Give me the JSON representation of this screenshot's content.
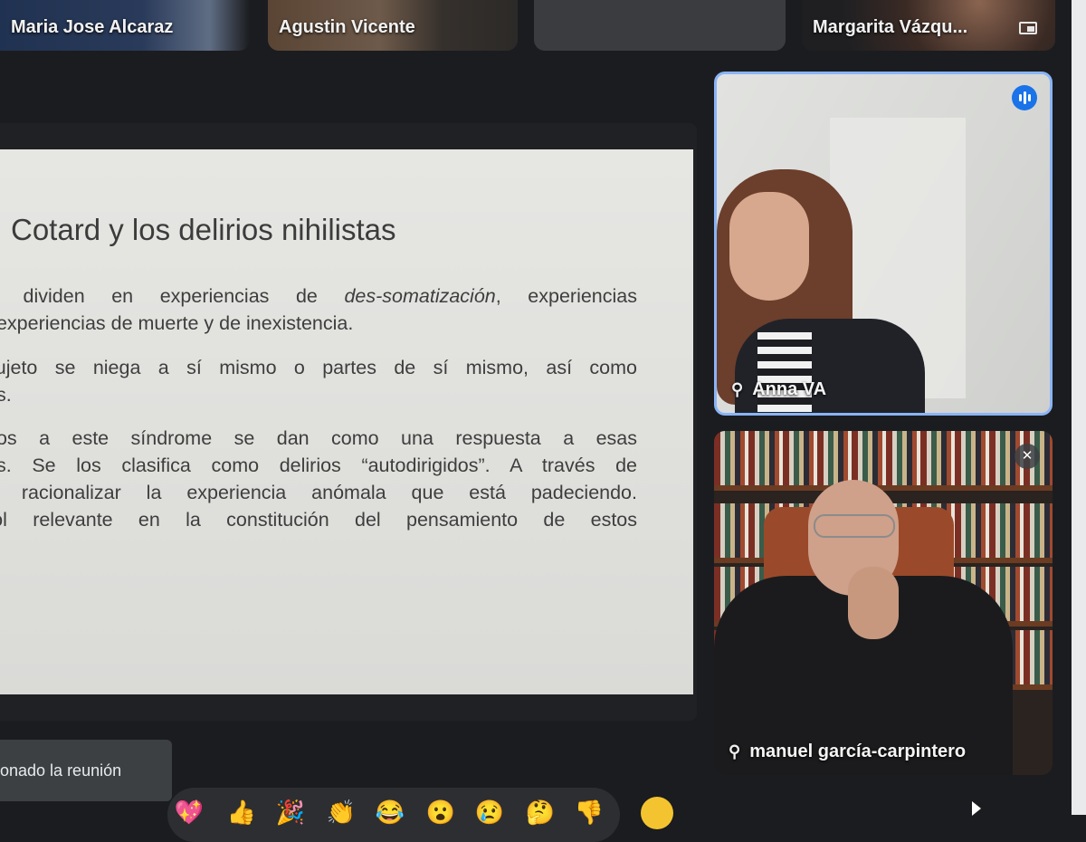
{
  "participants_strip": [
    {
      "name": "Maria Jose Alcaraz"
    },
    {
      "name": "Agustin Vicente"
    },
    {
      "name": ""
    },
    {
      "name": "Margarita Vázqu..."
    }
  ],
  "slide": {
    "title": "Cotard y los delirios nihilistas",
    "p1_line1_pre": "e dividen en experiencias de ",
    "p1_line1_em": "des-somatización",
    "p1_line1_post": ", experiencias",
    "p1_line2": ", experiencias de muerte y de inexistencia.",
    "p2_line1": "sujeto se niega a sí mismo o partes de sí mismo, así como",
    "p2_line2": "es.",
    "p3_line1": "dos a este síndrome se dan como una respuesta a esas",
    "p3_line2": "as. Se los clasifica como delirios “autodirigidos”. A través de",
    "p3_line3": "a racionalizar la experiencia anómala que está padeciendo.",
    "p3_line4": "rol relevante en la constitución del pensamiento de estos"
  },
  "tiles": {
    "anna": {
      "name": "Anna VA",
      "speaking": true
    },
    "manuel": {
      "name": "manuel garcía-carpintero",
      "muted": true
    }
  },
  "toast": {
    "text": "onado la reunión"
  },
  "reactions": [
    "💖",
    "👍",
    "🎉",
    "👏",
    "😂",
    "😮",
    "😢",
    "🤔",
    "👎"
  ],
  "colors": {
    "background": "#1b1c1f",
    "speaking_border": "#8ab4f8",
    "audio_indicator": "#1a73e8",
    "slide_bg": "#e3e3e0"
  }
}
